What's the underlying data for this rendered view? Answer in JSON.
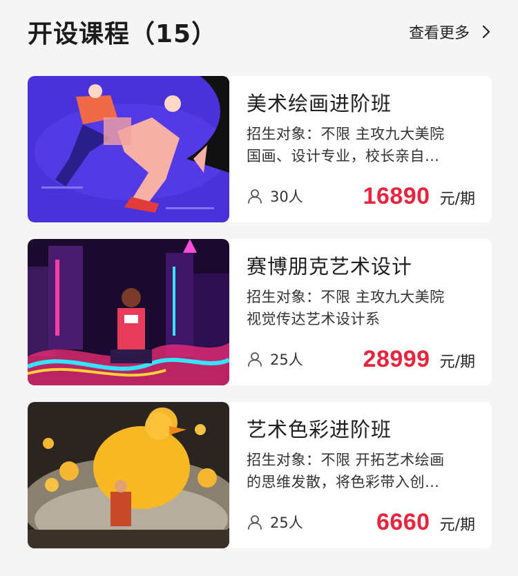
{
  "header": {
    "title": "开设课程（15）",
    "more_label": "查看更多"
  },
  "courses": [
    {
      "name": "美术绘画进阶班",
      "desc_line1": "招生对象：不限 主攻九大美院",
      "desc_line2": "国画、设计专业，校长亲自…",
      "people": "30人",
      "price": "16890",
      "unit": "元/期"
    },
    {
      "name": "赛博朋克艺术设计",
      "desc_line1": "招生对象：不限 主攻九大美院",
      "desc_line2": "视觉传达艺术设计系",
      "people": "25人",
      "price": "28999",
      "unit": "元/期"
    },
    {
      "name": "艺术色彩进阶班",
      "desc_line1": "招生对象：不限 开拓艺术绘画",
      "desc_line2": "的思维发散，将色彩带入创…",
      "people": "25人",
      "price": "6660",
      "unit": "元/期"
    }
  ],
  "icons": {
    "more": "chevron-right-icon",
    "people": "user-icon"
  },
  "colors": {
    "price": "#e8253f",
    "background": "#f5f5f6"
  }
}
